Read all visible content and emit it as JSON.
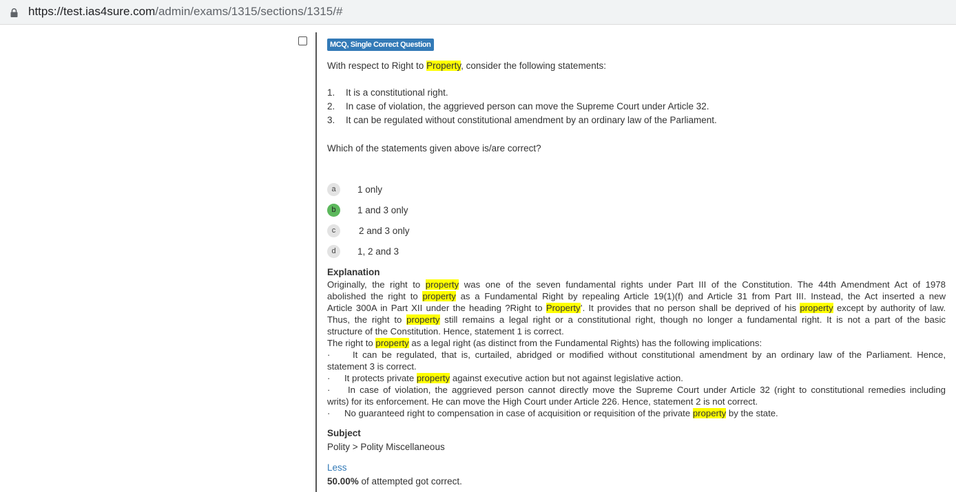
{
  "browser": {
    "url_host": "https://test.ias4sure.com",
    "url_path": "/admin/exams/1315/sections/1315/#"
  },
  "question": {
    "type_badge": "MCQ, Single Correct Question",
    "intro_before": "With respect to Right to ",
    "intro_highlight": "Property",
    "intro_after": ", consider the following statements:",
    "statements": [
      {
        "num": "1.",
        "text": "It is a constitutional right."
      },
      {
        "num": "2.",
        "text": "In case of violation, the aggrieved person can move the Supreme Court under Article 32."
      },
      {
        "num": "3.",
        "text": "It can be regulated without constitutional amendment by an ordinary law of the Parliament."
      }
    ],
    "ask": "Which of the statements given above is/are correct?",
    "options": [
      {
        "letter": "a",
        "text": "1 only"
      },
      {
        "letter": "b",
        "text": "1 and 3 only"
      },
      {
        "letter": "c",
        "text": "2 and 3 only"
      },
      {
        "letter": "d",
        "text": "1, 2 and 3"
      }
    ],
    "correct_option": "b",
    "correct_color": "#5cb85c"
  },
  "explanation": {
    "heading": "Explanation",
    "lines": [
      {
        "j": true,
        "parts": [
          [
            "Originally, the right to ",
            0
          ],
          [
            "property",
            1
          ],
          [
            " was one of the seven fundamental rights under Part III of the Constitution. The 44th Amendment Act of 1978",
            0
          ]
        ]
      },
      {
        "j": true,
        "parts": [
          [
            "abolished the right to ",
            0
          ],
          [
            "property",
            1
          ],
          [
            " as a Fundamental Right by repealing Article 19(1)(f) and Article 31 from Part III. Instead, the Act inserted a new",
            0
          ]
        ]
      },
      {
        "j": true,
        "parts": [
          [
            "Article 300A in Part XII under the heading ?Right to ",
            0
          ],
          [
            "Property",
            1
          ],
          [
            "’. It provides that no person shall be deprived of his ",
            0
          ],
          [
            "property",
            1
          ],
          [
            " except by authority of law.",
            0
          ]
        ]
      },
      {
        "j": true,
        "parts": [
          [
            "Thus, the right to ",
            0
          ],
          [
            "property",
            1
          ],
          [
            " still remains a legal right or a constitutional right, though no longer a fundamental right. It is not a part of the basic",
            0
          ]
        ]
      },
      {
        "j": false,
        "parts": [
          [
            "structure of the Constitution. Hence, statement 1 is correct.",
            0
          ]
        ]
      },
      {
        "j": false,
        "parts": [
          [
            "The right to ",
            0
          ],
          [
            "property",
            1
          ],
          [
            " as a legal right (as distinct from the Fundamental Rights) has the following implications:",
            0
          ]
        ]
      },
      {
        "j": true,
        "bullet": "·",
        "indent": 37,
        "parts": [
          [
            "It can be regulated, that is, curtailed, abridged or modified without constitutional amendment by an ordinary law of the Parliament. Hence,",
            0
          ]
        ]
      },
      {
        "j": false,
        "parts": [
          [
            "statement 3 is correct.",
            0
          ]
        ]
      },
      {
        "j": false,
        "bullet": "·",
        "indent": 25,
        "parts": [
          [
            "It protects private ",
            0
          ],
          [
            "property",
            1
          ],
          [
            " against executive action but not against legislative action.",
            0
          ]
        ]
      },
      {
        "j": true,
        "bullet": "·",
        "indent": 30,
        "parts": [
          [
            "In case of violation, the aggrieved person cannot directly move the Supreme Court under Article 32 (right to constitutional remedies including",
            0
          ]
        ]
      },
      {
        "j": false,
        "parts": [
          [
            "writs) for its enforcement. He can move the High Court under Article 226. Hence, statement 2 is not correct.",
            0
          ]
        ]
      },
      {
        "j": false,
        "bullet": "·",
        "indent": 25,
        "parts": [
          [
            "No guaranteed right to compensation in case of acquisition or requisition of the private ",
            0
          ],
          [
            "property",
            1
          ],
          [
            " by the state.",
            0
          ]
        ]
      }
    ]
  },
  "subject": {
    "heading": "Subject",
    "value": "Polity > Polity Miscellaneous"
  },
  "footer": {
    "less_link": "Less",
    "stat_value": "50.00%",
    "stat_text": " of attempted got correct."
  },
  "colors": {
    "highlight": "#ffff00",
    "badge": "#337ab7",
    "link": "#337ab7"
  }
}
